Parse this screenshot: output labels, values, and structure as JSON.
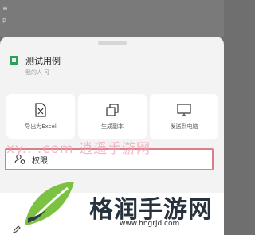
{
  "top_bar": {
    "glyphs": [
      "≡",
      "P"
    ]
  },
  "doc": {
    "title": "测试用例",
    "subtitle": "我的人 可"
  },
  "actions": [
    {
      "label": "导出为Excel",
      "icon": "excel-export-icon"
    },
    {
      "label": "生成副本",
      "icon": "copy-icon"
    },
    {
      "label": "发送到电脑",
      "icon": "monitor-icon"
    }
  ],
  "permission": {
    "label": "权限",
    "icon": "user-lock-icon"
  },
  "watermark": {
    "text": "xy.. .com 逍遥手游网"
  },
  "logo": {
    "name": "格润手游网",
    "url": "www.hngrjd.com"
  },
  "colors": {
    "highlight_border": "#d97f87",
    "sheet_icon": "#2e9e5d",
    "logo_green": "#7cc242"
  }
}
